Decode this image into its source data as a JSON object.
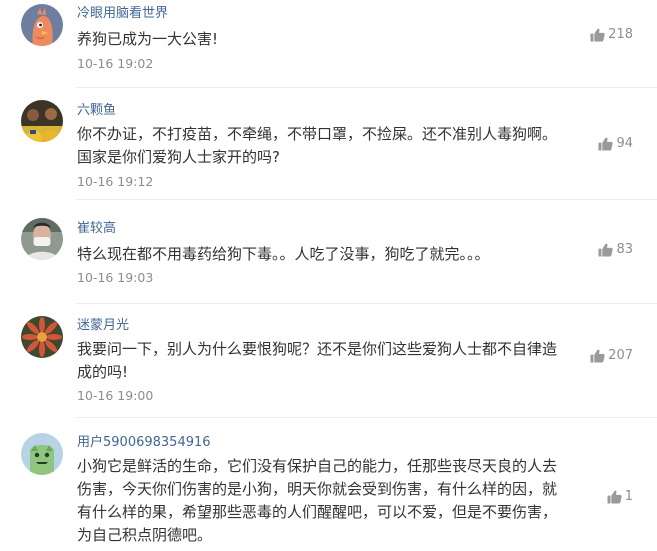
{
  "comments": [
    {
      "username": "冷眼用脑看世界",
      "avatar_icon": "orange-bird-icon",
      "content": "养狗已成为一大公害!",
      "time": "10-16 19:02",
      "likes": "218"
    },
    {
      "username": "六颗鱼",
      "avatar_icon": "basketball-players-photo",
      "content": "你不办证，不打疫苗，不牵绳，不带口罩，不捡屎。还不准别人毒狗啊。国家是你们爱狗人士家开的吗?",
      "time": "10-16 19:12",
      "likes": "94"
    },
    {
      "username": "崔较高",
      "avatar_icon": "masked-man-photo",
      "content": "特么现在都不用毒药给狗下毒。。人吃了没事，狗吃了就完。。。",
      "time": "10-16 19:03",
      "likes": "83"
    },
    {
      "username": "迷蒙月光",
      "avatar_icon": "flower-photo",
      "content": "我要问一下，别人为什么要恨狗呢？还不是你们这些爱狗人士都不自律造成的吗!",
      "time": "10-16 19:00",
      "likes": "207"
    },
    {
      "username": "用户5900698354916",
      "avatar_icon": "green-monster-icon",
      "content": "小狗它是鲜活的生命，它们没有保护自己的能力，任那些丧尽天良的人去伤害，今天你们伤害的是小狗，明天你就会受到伤害，有什么样的因，就有什么样的果，希望那些恶毒的人们醒醒吧，可以不爱，但是不要伤害，为自己积点阴德吧。",
      "time": "",
      "likes": "1"
    }
  ],
  "colors": {
    "username": "#406599",
    "content": "#333333",
    "meta": "#8c8c8c"
  }
}
